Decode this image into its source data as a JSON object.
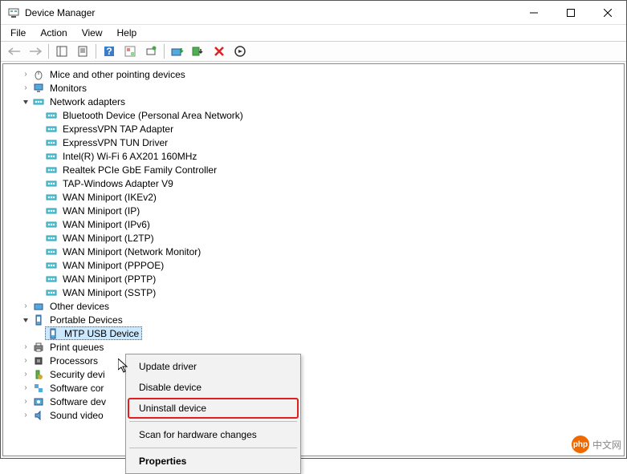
{
  "window": {
    "title": "Device Manager"
  },
  "menu": {
    "file": "File",
    "action": "Action",
    "view": "View",
    "help": "Help"
  },
  "tree": {
    "mice": "Mice and other pointing devices",
    "monitors": "Monitors",
    "network": "Network adapters",
    "net_items": [
      "Bluetooth Device (Personal Area Network)",
      "ExpressVPN TAP Adapter",
      "ExpressVPN TUN Driver",
      "Intel(R) Wi-Fi 6 AX201 160MHz",
      "Realtek PCIe GbE Family Controller",
      "TAP-Windows Adapter V9",
      "WAN Miniport (IKEv2)",
      "WAN Miniport (IP)",
      "WAN Miniport (IPv6)",
      "WAN Miniport (L2TP)",
      "WAN Miniport (Network Monitor)",
      "WAN Miniport (PPPOE)",
      "WAN Miniport (PPTP)",
      "WAN Miniport (SSTP)"
    ],
    "other": "Other devices",
    "portable": "Portable Devices",
    "mtp": "MTP USB Device",
    "print": "Print queues",
    "proc": "Processors",
    "security": "Security devi",
    "swcomp": "Software cor",
    "swdev": "Software dev",
    "sound": "Sound  video"
  },
  "ctx": {
    "update": "Update driver",
    "disable": "Disable device",
    "uninstall": "Uninstall device",
    "scan": "Scan for hardware changes",
    "props": "Properties"
  },
  "watermark": {
    "text": "中文网",
    "logo": "php"
  }
}
